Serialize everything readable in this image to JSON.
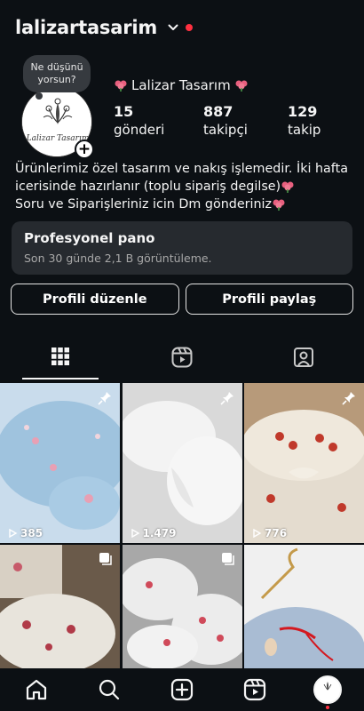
{
  "header": {
    "username": "lalizartasarim"
  },
  "note": {
    "text": "Ne düşünü yorsun?"
  },
  "profile": {
    "display_name": "Lalizar Tasarım",
    "stats": [
      {
        "num": "15",
        "label": "gönderi"
      },
      {
        "num": "887",
        "label": "takipçi"
      },
      {
        "num": "129",
        "label": "takip"
      }
    ]
  },
  "bio": {
    "line1": "Ürünlerimiz özel tasarım ve nakış işlemedir.  İki hafta",
    "line2": "icerisinde hazırlanır (toplu sipariş degilse)",
    "line3": "Soru ve Siparişleriniz icin Dm gönderiniz"
  },
  "dashboard": {
    "title": "Profesyonel pano",
    "subtitle": "Son 30 günde 2,1 B görüntüleme."
  },
  "buttons": {
    "edit": "Profili düzenle",
    "share": "Profili paylaş"
  },
  "tabs": [
    "grid-icon",
    "reels-icon",
    "tagged-icon"
  ],
  "posts": [
    {
      "views": "385",
      "pinned": true,
      "colors": [
        "#9fc3de",
        "#c9dcec"
      ]
    },
    {
      "views": "1.479",
      "pinned": true,
      "colors": [
        "#d9d9d9",
        "#f3f3f3"
      ]
    },
    {
      "views": "776",
      "pinned": true,
      "colors": [
        "#b79a7a",
        "#e4dccf"
      ]
    },
    {
      "views": "",
      "pinned": false,
      "multi": true,
      "colors": [
        "#6a5a4a",
        "#e8e4dc"
      ]
    },
    {
      "views": "",
      "pinned": false,
      "multi": true,
      "colors": [
        "#a8a8a8",
        "#ececec"
      ]
    },
    {
      "views": "",
      "pinned": false,
      "colors": [
        "#f0f0f0",
        "#a9bcd3"
      ]
    }
  ],
  "navbar": [
    "home-icon",
    "search-icon",
    "create-icon",
    "reels-icon",
    "profile-avatar"
  ],
  "colors": {
    "bg": "#0c1014",
    "card": "#262a2f",
    "notification": "#ff3040"
  }
}
